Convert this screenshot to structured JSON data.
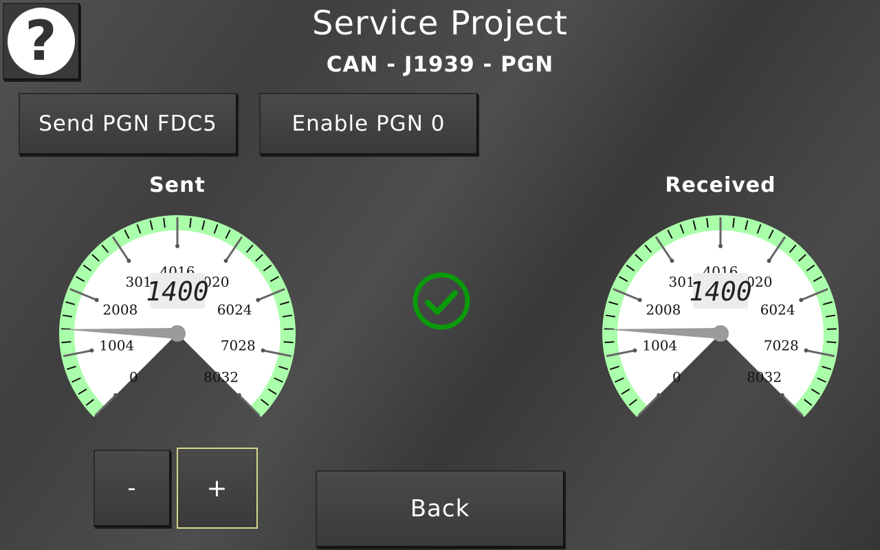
{
  "header": {
    "title": "Service Project",
    "subtitle": "CAN - J1939 - PGN",
    "help_label": "?"
  },
  "buttons": {
    "send_pgn": "Send PGN FDC5",
    "enable_pgn": "Enable PGN 0",
    "minus": "-",
    "plus": "+",
    "back": "Back"
  },
  "gauges": [
    {
      "label": "Sent",
      "value": 1400,
      "display": "1400",
      "min": 0,
      "max": 8032,
      "ticks": [
        "0",
        "1004",
        "2008",
        "3012",
        "4016",
        "5020",
        "6024",
        "7028",
        "8032"
      ]
    },
    {
      "label": "Received",
      "value": 1400,
      "display": "1400",
      "min": 0,
      "max": 8032,
      "ticks": [
        "0",
        "1004",
        "2008",
        "3012",
        "4016",
        "5020",
        "6024",
        "7028",
        "8032"
      ]
    }
  ],
  "status": {
    "icon": "check-circle-icon",
    "color": "#0a9a0a"
  },
  "colors": {
    "gauge_band": "#aaffaa",
    "needle": "#9a9a9a",
    "hub": "#9a9a9a"
  }
}
